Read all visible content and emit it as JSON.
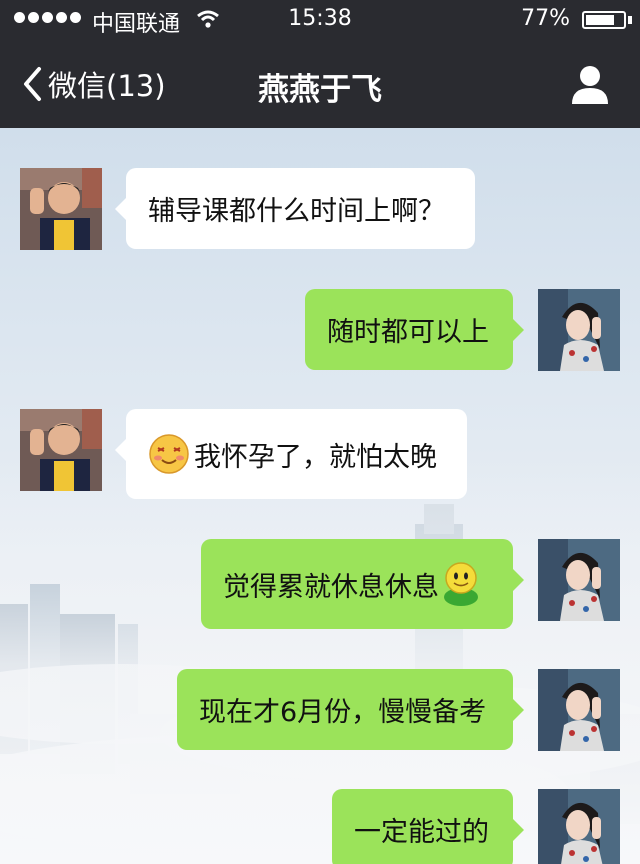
{
  "status": {
    "carrier": "中国联通",
    "time": "15:38",
    "battery": "77%",
    "battery_level": 0.77
  },
  "nav": {
    "back_label": "微信(13)",
    "title": "燕燕于飞"
  },
  "messages": [
    {
      "side": "in",
      "text": "辅导课都什么时间上啊？"
    },
    {
      "side": "out",
      "text": "随时都可以上"
    },
    {
      "side": "in",
      "text": "我怀孕了，就怕太晚",
      "emoji": "blushing-face-emoji"
    },
    {
      "side": "out",
      "text": "觉得累就休息休息",
      "emoji": "green-smiley-emoji"
    },
    {
      "side": "out",
      "text": "现在才6月份，慢慢备考"
    },
    {
      "side": "out",
      "text": "一定能过的"
    }
  ],
  "colors": {
    "topbar": "#2a2b30",
    "outgoing_bubble": "#9be35a",
    "incoming_bubble": "#ffffff"
  }
}
